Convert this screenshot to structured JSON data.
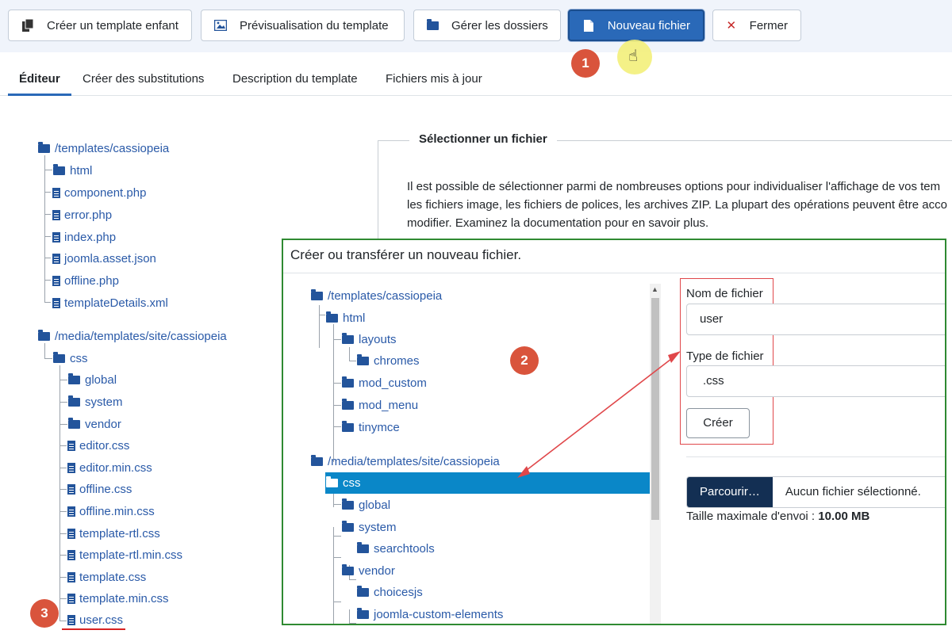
{
  "toolbar": {
    "child_template": "Créer un template enfant",
    "preview": "Prévisualisation du template",
    "folders": "Gérer les dossiers",
    "new_file": "Nouveau fichier",
    "close": "Fermer"
  },
  "tabs": [
    "Éditeur",
    "Créer des substitutions",
    "Description du template",
    "Fichiers mis à jour"
  ],
  "left_tree": {
    "root1": "/templates/cassiopeia",
    "root1_items": [
      "html",
      "component.php",
      "error.php",
      "index.php",
      "joomla.asset.json",
      "offline.php",
      "templateDetails.xml"
    ],
    "root2": "/media/templates/site/cassiopeia",
    "css": "css",
    "css_folders": [
      "global",
      "system",
      "vendor"
    ],
    "css_files": [
      "editor.css",
      "editor.min.css",
      "offline.css",
      "offline.min.css",
      "template-rtl.css",
      "template-rtl.min.css",
      "template.css",
      "template.min.css",
      "user.css"
    ]
  },
  "fieldset": {
    "legend": "Sélectionner un fichier",
    "lines": [
      "Il est possible de sélectionner parmi de nombreuses options pour individualiser l'affichage de vos tem",
      "les fichiers image, les fichiers de polices, les archives ZIP. La plupart des opérations peuvent être acco",
      "modifier. Examinez la documentation pour en savoir plus."
    ]
  },
  "modal": {
    "title": "Créer ou transférer un nouveau fichier.",
    "tree": {
      "root1": "/templates/cassiopeia",
      "html": "html",
      "layouts": "layouts",
      "chromes": "chromes",
      "mod_custom": "mod_custom",
      "mod_menu": "mod_menu",
      "tinymce": "tinymce",
      "root2": "/media/templates/site/cassiopeia",
      "css": "css",
      "global": "global",
      "system": "system",
      "searchtools": "searchtools",
      "vendor": "vendor",
      "choicesjs": "choicesjs",
      "joomla_custom_elements": "joomla-custom-elements"
    },
    "filename_label": "Nom de fichier",
    "filename_value": "user",
    "filetype_label": "Type de fichier",
    "filetype_value": ".css",
    "create_button": "Créer",
    "browse_button": "Parcourir…",
    "no_file": "Aucun fichier sélectionné.",
    "max_size_label": "Taille maximale d'envoi : ",
    "max_size_value": "10.00 MB"
  },
  "badges": [
    "1",
    "2",
    "3"
  ],
  "colors": {
    "primary": "#2a69b8",
    "link": "#2a5aa8",
    "selected": "#0a87c8",
    "badge": "#d9543c",
    "modal_border": "#2f8a32",
    "annotation_red": "#e0474a"
  }
}
